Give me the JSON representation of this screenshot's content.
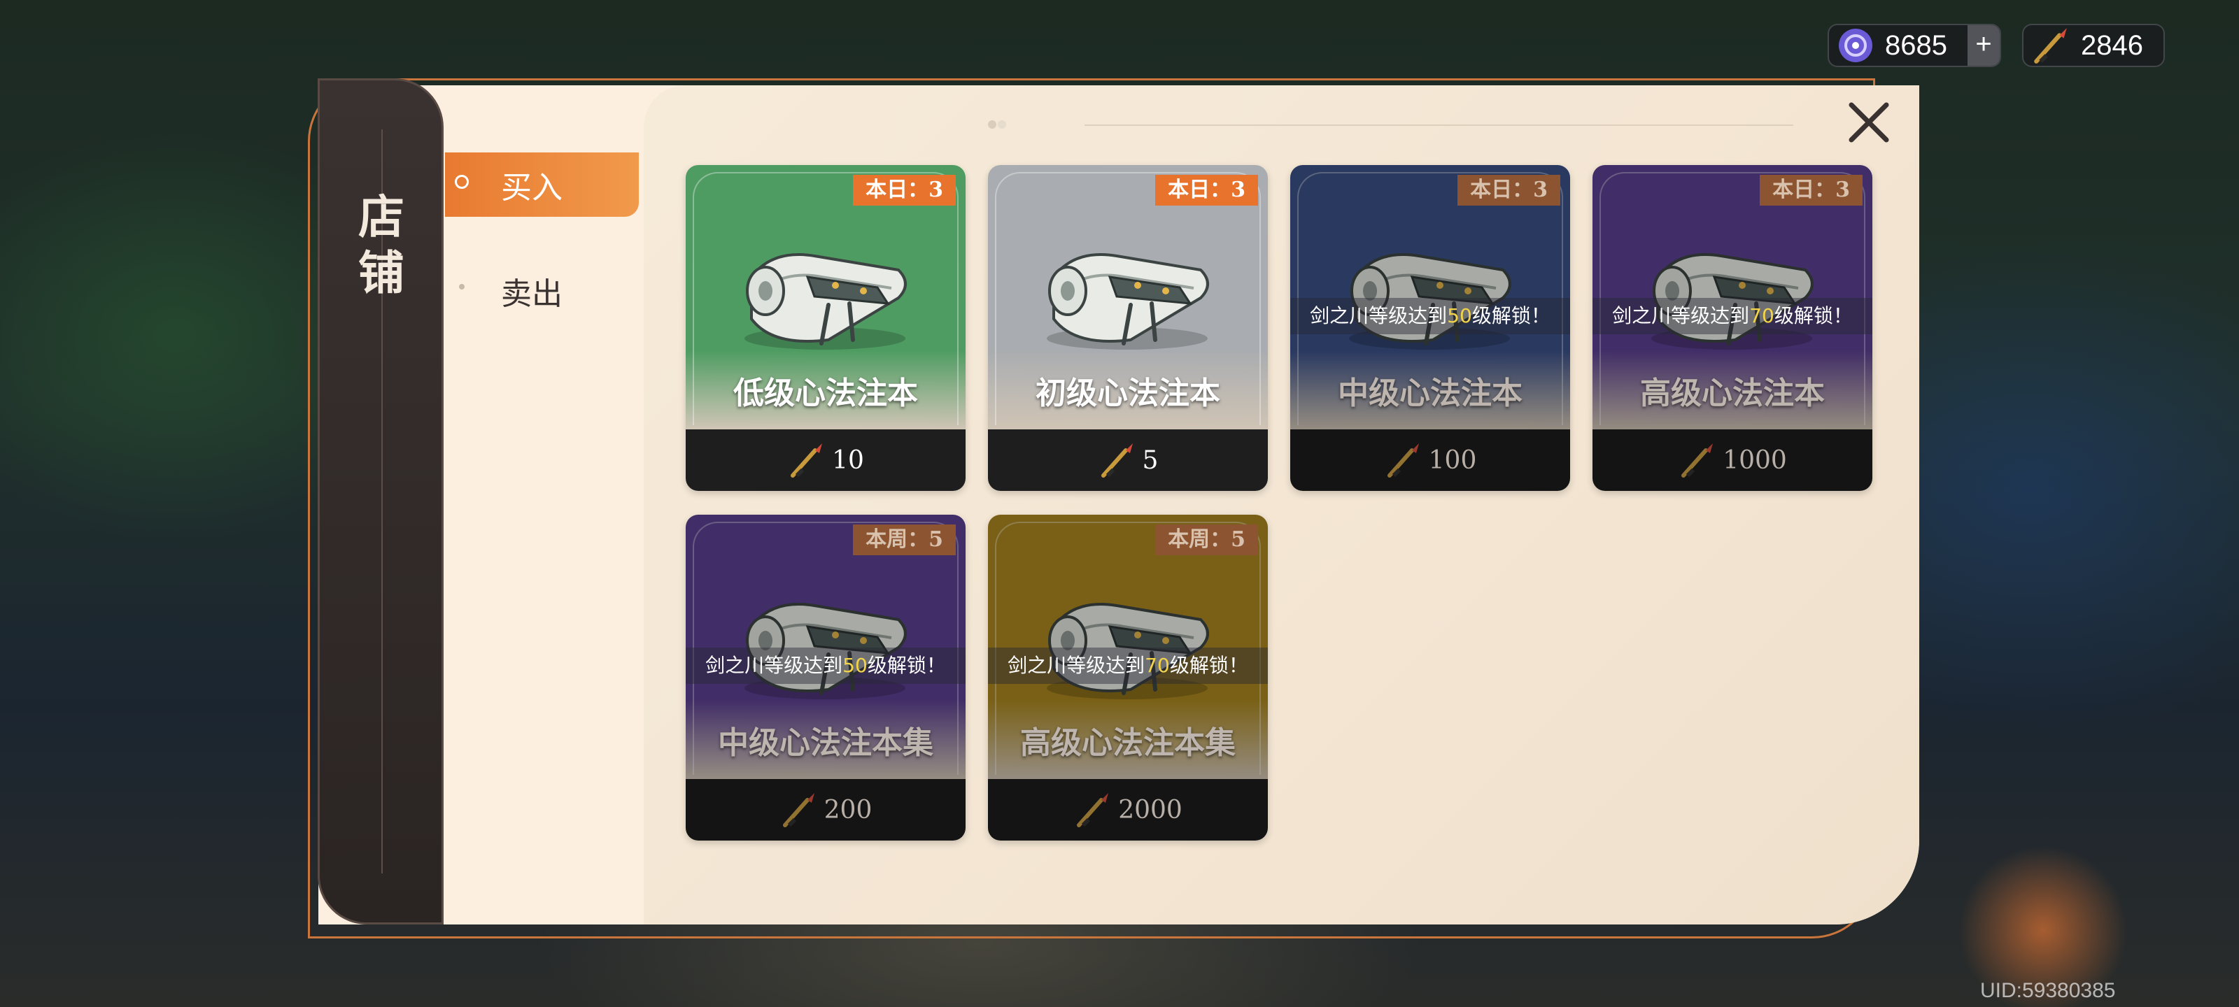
{
  "currencies": {
    "jade": {
      "value": "8685",
      "plus": "+",
      "icon": "jade-currency-icon"
    },
    "brush": {
      "value": "2846",
      "icon": "brush-currency-icon"
    }
  },
  "uid": "UID:59380385",
  "shop": {
    "title_line1": "店",
    "title_line2": "铺",
    "tabs": {
      "buy": "买入",
      "sell": "卖出"
    },
    "active_tab": "buy"
  },
  "items": [
    {
      "name": "低级心法注本",
      "limit": "本日：3",
      "price": "10",
      "locked": false,
      "bg": "#4e9c62"
    },
    {
      "name": "初级心法注本",
      "limit": "本日：3",
      "price": "5",
      "locked": false,
      "bg": "#a9acb0"
    },
    {
      "name": "中级心法注本",
      "limit": "本日：3",
      "price": "100",
      "locked": true,
      "lock_prefix": "剑之川等级达到",
      "lock_level": "50",
      "lock_suffix": "级解锁！",
      "bg": "#3a4f86"
    },
    {
      "name": "高级心法注本",
      "limit": "本日：3",
      "price": "1000",
      "locked": true,
      "lock_prefix": "剑之川等级达到",
      "lock_level": "70",
      "lock_suffix": "级解锁！",
      "bg": "#5b3f8f"
    },
    {
      "name": "中级心法注本集",
      "limit": "本周：5",
      "price": "200",
      "locked": true,
      "lock_prefix": "剑之川等级达到",
      "lock_level": "50",
      "lock_suffix": "级解锁！",
      "bg": "#5b3f8f"
    },
    {
      "name": "高级心法注本集",
      "limit": "本周：5",
      "price": "2000",
      "locked": true,
      "lock_prefix": "剑之川等级达到",
      "lock_level": "70",
      "lock_suffix": "级解锁！",
      "bg": "#a9861f"
    }
  ],
  "colors": {
    "accent": "#e8732c",
    "lock_level": "#f2d34a"
  }
}
